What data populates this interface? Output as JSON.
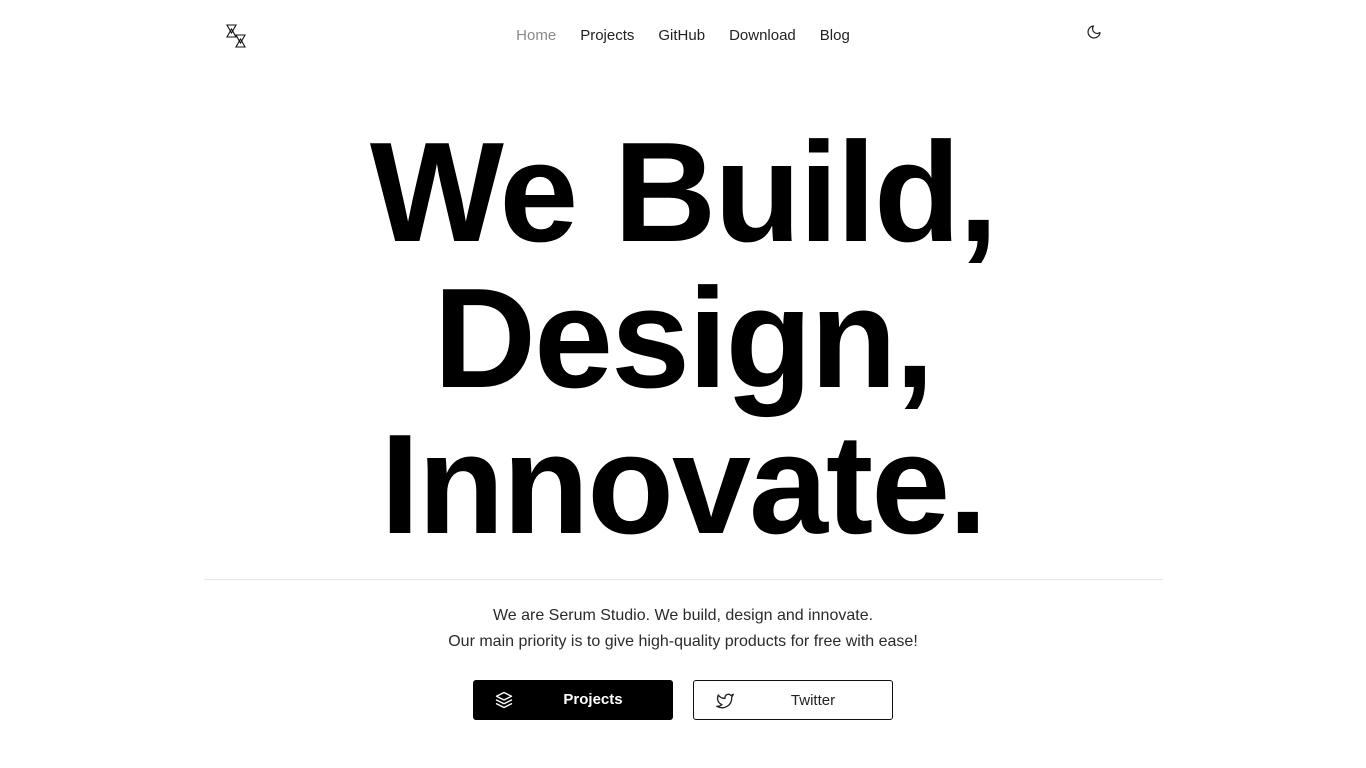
{
  "header": {
    "logo_name": "hexagram-logo",
    "nav": [
      {
        "label": "Home",
        "active": true
      },
      {
        "label": "Projects",
        "active": false
      },
      {
        "label": "GitHub",
        "active": false
      },
      {
        "label": "Download",
        "active": false
      },
      {
        "label": "Blog",
        "active": false
      }
    ],
    "theme_toggle_icon": "moon-icon"
  },
  "hero": {
    "lines": [
      "We Build,",
      "Design,",
      "Innovate."
    ]
  },
  "tagline": {
    "line1": "We are Serum Studio. We build, design and innovate.",
    "line2": "Our main priority is to give high-quality products for free with ease!"
  },
  "buttons": {
    "primary": {
      "label": "Projects",
      "icon": "layers-icon"
    },
    "secondary": {
      "label": "Twitter",
      "icon": "twitter-icon"
    }
  },
  "colors": {
    "background": "#ffffff",
    "text": "#000000",
    "nav_active": "#8a8a8a",
    "divider": "#e6e6e6"
  }
}
